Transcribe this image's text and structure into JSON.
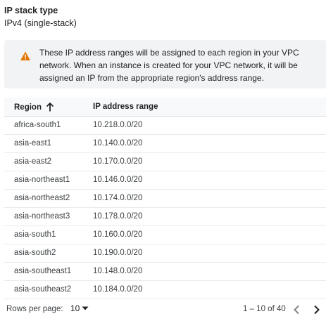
{
  "ip_stack": {
    "label": "IP stack type",
    "value": "IPv4 (single-stack)"
  },
  "notice": {
    "icon": "warning-icon",
    "color": "#e37400",
    "text": "These IP address ranges will be assigned to each region in your VPC network. When an instance is created for your VPC network, it will be assigned an IP from the appropriate region's address range."
  },
  "table": {
    "columns": {
      "region": "Region",
      "range": "IP address range"
    },
    "sort": {
      "column": "region",
      "direction": "ascending"
    },
    "rows": [
      {
        "region": "africa-south1",
        "range": "10.218.0.0/20"
      },
      {
        "region": "asia-east1",
        "range": "10.140.0.0/20"
      },
      {
        "region": "asia-east2",
        "range": "10.170.0.0/20"
      },
      {
        "region": "asia-northeast1",
        "range": "10.146.0.0/20"
      },
      {
        "region": "asia-northeast2",
        "range": "10.174.0.0/20"
      },
      {
        "region": "asia-northeast3",
        "range": "10.178.0.0/20"
      },
      {
        "region": "asia-south1",
        "range": "10.160.0.0/20"
      },
      {
        "region": "asia-south2",
        "range": "10.190.0.0/20"
      },
      {
        "region": "asia-southeast1",
        "range": "10.148.0.0/20"
      },
      {
        "region": "asia-southeast2",
        "range": "10.184.0.0/20"
      }
    ]
  },
  "pagination": {
    "rows_per_page_label": "Rows per page:",
    "rows_per_page_value": "10",
    "range_text": "1 – 10 of 40"
  }
}
